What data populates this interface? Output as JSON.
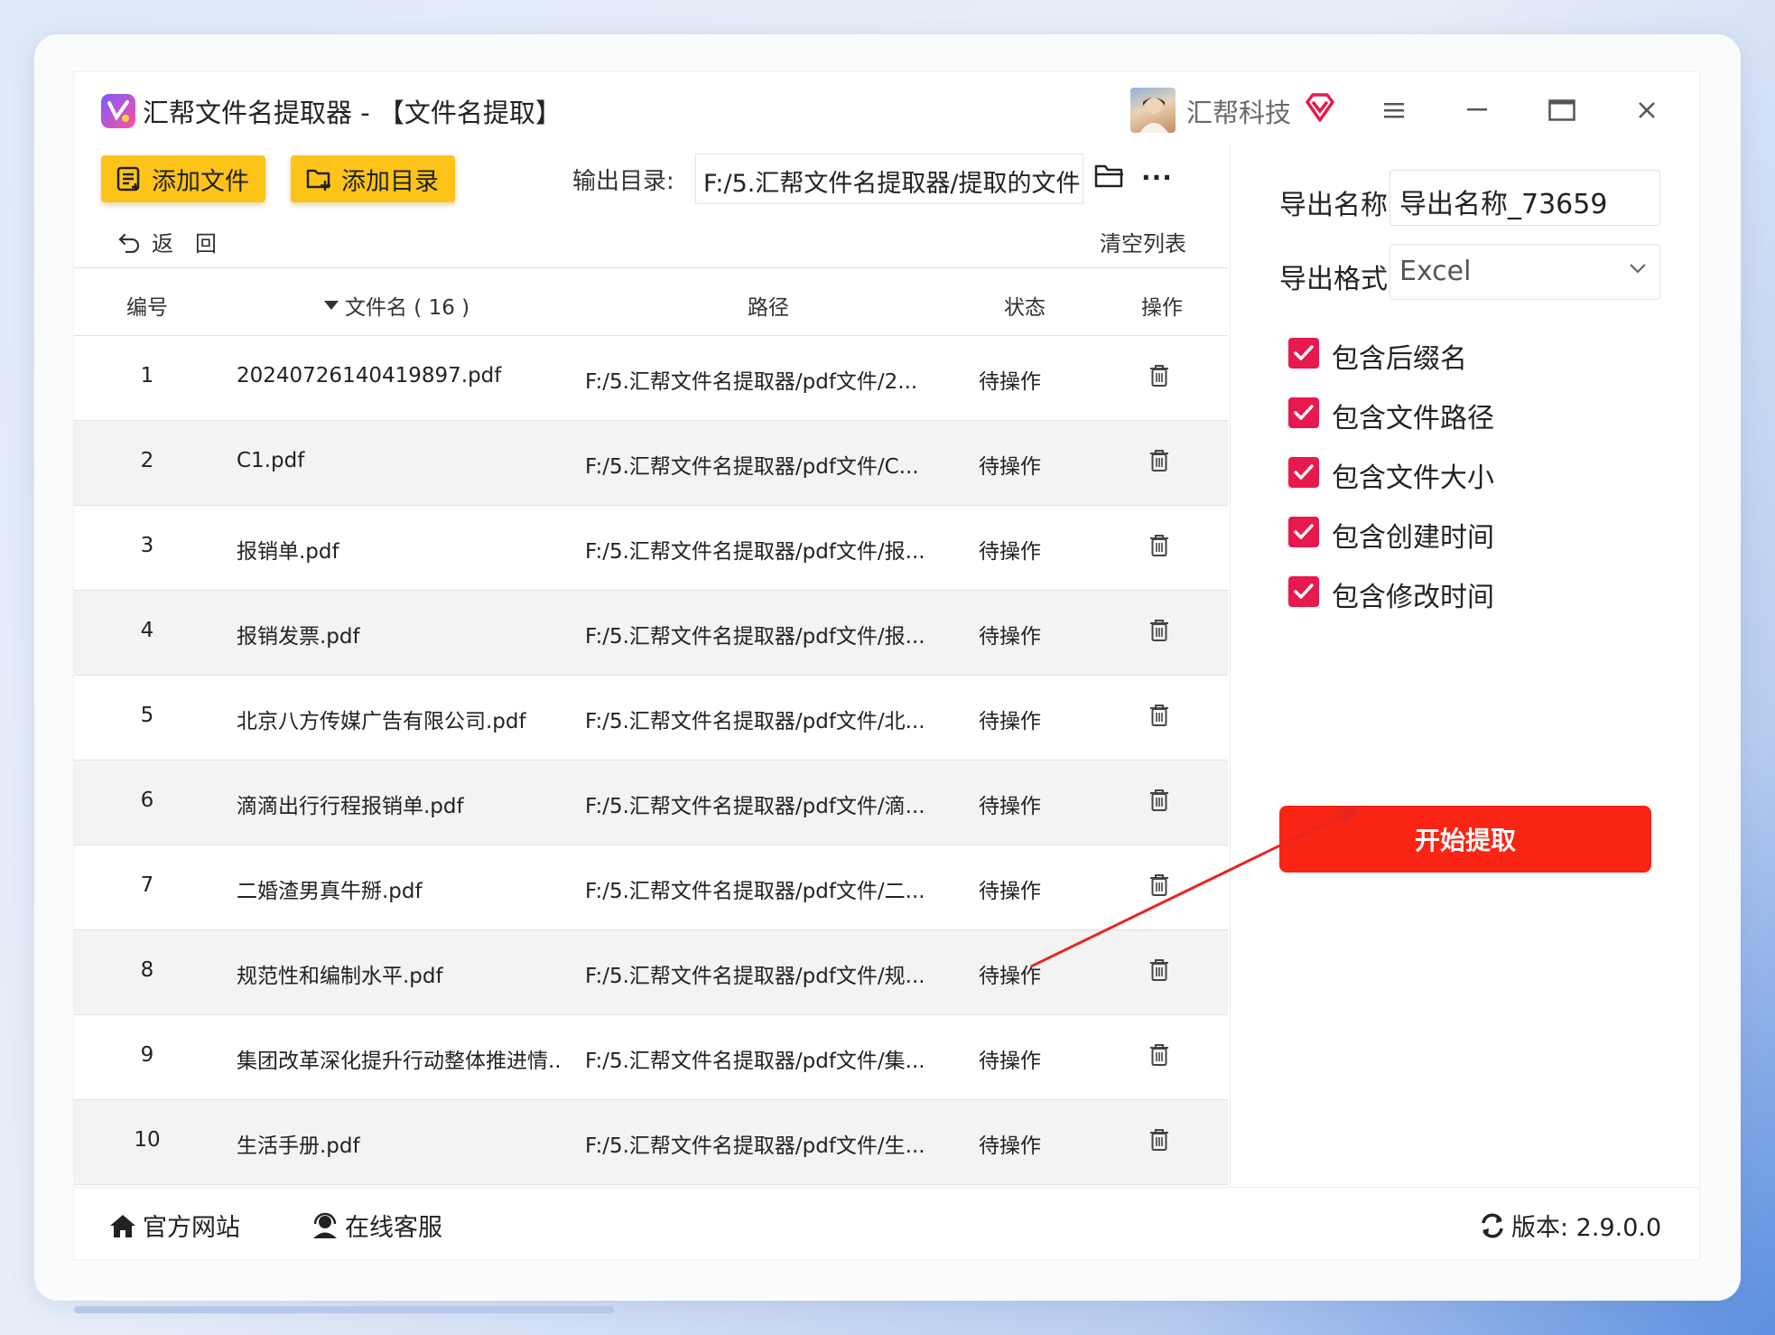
{
  "app": {
    "title": "汇帮文件名提取器 - 【文件名提取】",
    "user_name": "汇帮科技"
  },
  "toolbar": {
    "add_file_label": "添加文件",
    "add_dir_label": "添加目录",
    "output_label": "输出目录:",
    "output_path": "F:/5.汇帮文件名提取器/提取的文件",
    "more_label": "···",
    "back_label": "返　回",
    "clear_label": "清空列表"
  },
  "table": {
    "headers": {
      "number": "编号",
      "name": "文件名 ( 16 )",
      "path": "路径",
      "status": "状态",
      "action": "操作"
    },
    "rows": [
      {
        "num": "1",
        "name": "20240726140419897.pdf",
        "path": "F:/5.汇帮文件名提取器/pdf文件/2...",
        "status": "待操作"
      },
      {
        "num": "2",
        "name": "C1.pdf",
        "path": "F:/5.汇帮文件名提取器/pdf文件/C...",
        "status": "待操作"
      },
      {
        "num": "3",
        "name": "报销单.pdf",
        "path": "F:/5.汇帮文件名提取器/pdf文件/报...",
        "status": "待操作"
      },
      {
        "num": "4",
        "name": "报销发票.pdf",
        "path": "F:/5.汇帮文件名提取器/pdf文件/报...",
        "status": "待操作"
      },
      {
        "num": "5",
        "name": "北京八方传媒广告有限公司.pdf",
        "path": "F:/5.汇帮文件名提取器/pdf文件/北...",
        "status": "待操作"
      },
      {
        "num": "6",
        "name": "滴滴出行行程报销单.pdf",
        "path": "F:/5.汇帮文件名提取器/pdf文件/滴...",
        "status": "待操作"
      },
      {
        "num": "7",
        "name": "二婚渣男真牛掰.pdf",
        "path": "F:/5.汇帮文件名提取器/pdf文件/二...",
        "status": "待操作"
      },
      {
        "num": "8",
        "name": "规范性和编制水平.pdf",
        "path": "F:/5.汇帮文件名提取器/pdf文件/规...",
        "status": "待操作"
      },
      {
        "num": "9",
        "name": "集团改革深化提升行动整体推进情...",
        "path": "F:/5.汇帮文件名提取器/pdf文件/集...",
        "status": "待操作"
      },
      {
        "num": "10",
        "name": "生活手册.pdf",
        "path": "F:/5.汇帮文件名提取器/pdf文件/生...",
        "status": "待操作"
      }
    ]
  },
  "panel": {
    "export_name_label": "导出名称",
    "export_name_value": "导出名称_73659",
    "export_format_label": "导出格式",
    "export_format_value": "Excel",
    "options": [
      {
        "label": "包含后缀名",
        "checked": true
      },
      {
        "label": "包含文件路径",
        "checked": true
      },
      {
        "label": "包含文件大小",
        "checked": true
      },
      {
        "label": "包含创建时间",
        "checked": true
      },
      {
        "label": "包含修改时间",
        "checked": true
      }
    ],
    "start_label": "开始提取"
  },
  "footer": {
    "website_label": "官方网站",
    "service_label": "在线客服",
    "version_label": "版本: 2.9.0.0"
  },
  "colors": {
    "accent_yellow": "#fcc419",
    "start_red": "#fa2414",
    "checkbox_pink": "#e8194f",
    "annotation_arrow": "#e8251f"
  },
  "icons": [
    "app-logo-icon",
    "vip-icon",
    "menu-icon",
    "minimize-icon",
    "maximize-icon",
    "close-icon",
    "add-file-icon",
    "add-folder-icon",
    "folder-icon",
    "more-icon",
    "back-icon",
    "sort-down-icon",
    "trash-icon",
    "check-icon",
    "chevron-down-icon",
    "home-icon",
    "support-icon",
    "refresh-icon"
  ]
}
